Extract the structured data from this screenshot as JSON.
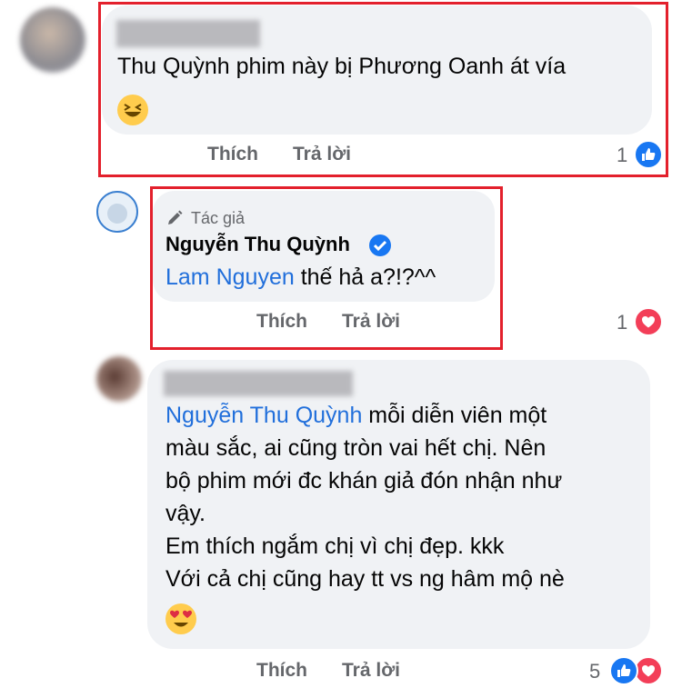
{
  "comments": [
    {
      "text": "Thu Quỳnh phim này bị Phương Oanh át vía",
      "emoji": "laughing-emoji",
      "actions": {
        "like": "Thích",
        "reply": "Trả lời"
      },
      "reaction_count": "1",
      "reactions": [
        "like"
      ]
    },
    {
      "author_badge": "Tác giả",
      "author": "Nguyễn Thu Quỳnh",
      "mention": "Lam Nguyen",
      "text": " thế hả a?!?^^",
      "actions": {
        "like": "Thích",
        "reply": "Trả lời"
      },
      "reaction_count": "1",
      "reactions": [
        "love"
      ]
    },
    {
      "mention": "Nguyễn Thu Quỳnh",
      "line1": " mỗi diễn viên một",
      "line2": "màu sắc, ai cũng tròn vai hết chị. Nên",
      "line3": "bộ phim mới đc khán giả đón nhận như",
      "line4": "vậy.",
      "line5": "Em thích ngắm chị vì chị đẹp. kkk",
      "line6": "Với cả chị cũng hay tt vs ng hâm mộ nè",
      "emoji": "heart-eyes-emoji",
      "actions": {
        "like": "Thích",
        "reply": "Trả lời"
      },
      "reaction_count": "5",
      "reactions": [
        "like",
        "love"
      ]
    }
  ],
  "colors": {
    "highlight": "#e3202c",
    "link": "#216fdb",
    "like": "#1877f2",
    "love": "#f33e58"
  }
}
